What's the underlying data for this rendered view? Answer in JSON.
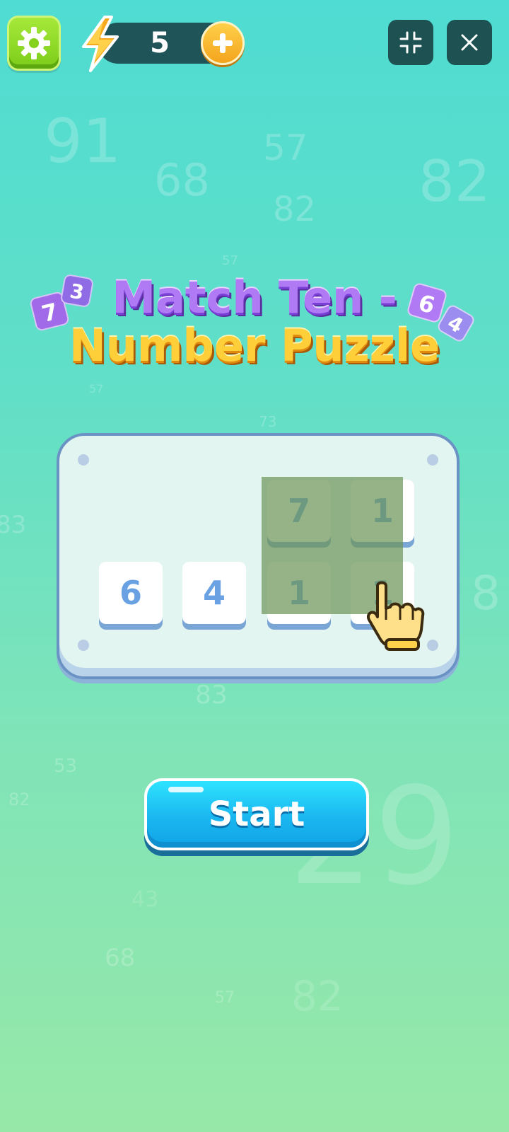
{
  "topbar": {
    "energy_count": "5",
    "settings_icon": "gear-icon",
    "energy_icon": "lightning-bolt-icon",
    "add_icon": "plus-icon",
    "minimize_icon": "collapse-icon",
    "close_icon": "close-icon"
  },
  "title": {
    "line1": "Match Ten -",
    "line2": "Number Puzzle",
    "deco_tiles": [
      "7",
      "3",
      "6",
      "4"
    ]
  },
  "board": {
    "row1": [
      "7",
      "1"
    ],
    "row2": [
      "6",
      "4",
      "1",
      "1"
    ]
  },
  "start_button": {
    "label": "Start"
  },
  "background_numbers": [
    "91",
    "57",
    "68",
    "82",
    "82",
    "57",
    "57",
    "73",
    "83",
    "83",
    "8",
    "53",
    "82",
    "29",
    "43",
    "68",
    "57",
    "82"
  ],
  "colors": {
    "settings_button": "#8ad82a",
    "energy_bar": "#1f5558",
    "plus_button": "#f7b52c",
    "dark_button": "#1d5152",
    "start_button": "#1ab7f0",
    "tile_digit": "#6aa1e2"
  }
}
